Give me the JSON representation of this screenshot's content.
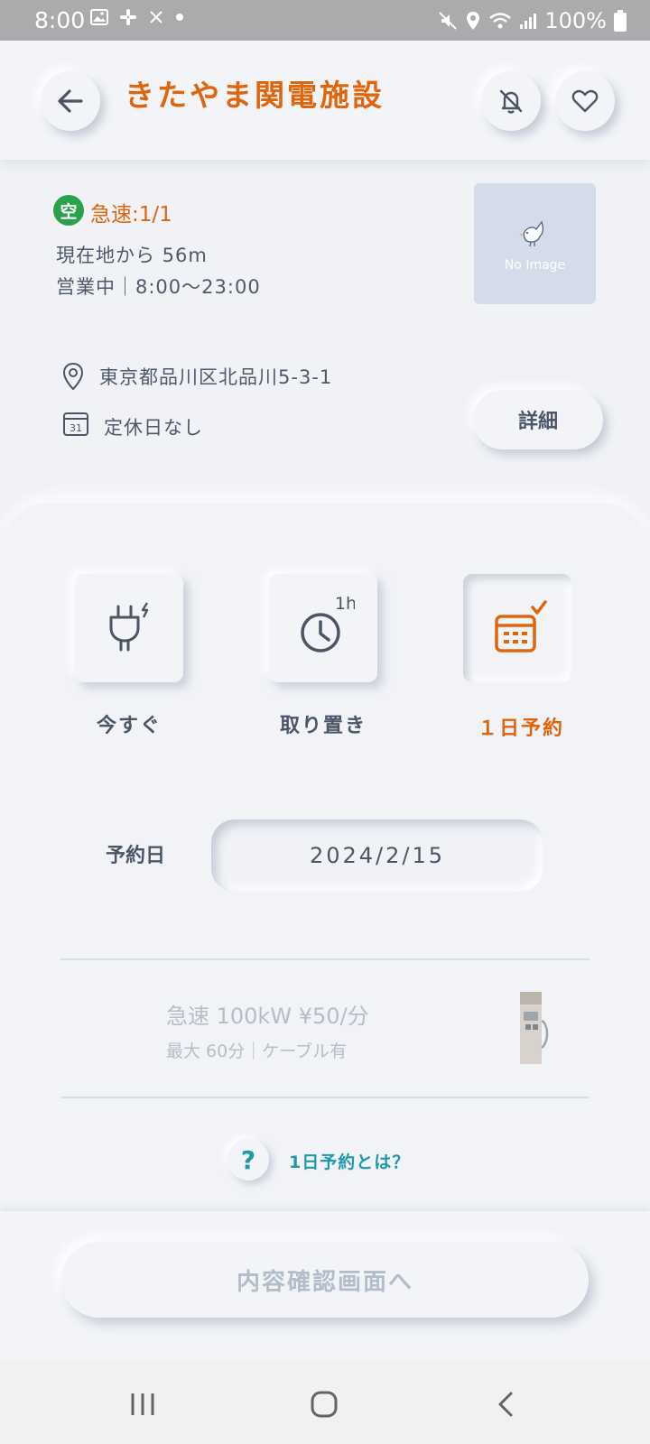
{
  "status_bar": {
    "time": "8:00",
    "battery": "100%",
    "left_icons": [
      "gallery-icon",
      "slack-icon",
      "x-icon",
      "dot-icon"
    ],
    "right_icons": [
      "mute-icon",
      "location-icon",
      "wifi-icon",
      "signal-icon",
      "battery-icon"
    ]
  },
  "header": {
    "title": "きたやま関電施設",
    "accent_color": "#e0660e"
  },
  "station": {
    "availability_badge": "空",
    "availability": "急速:1/1",
    "distance": "現在地から 56m",
    "hours": "営業中｜8:00～23:00",
    "image_placeholder": "No Image",
    "address": "東京都品川区北品川5-3-1",
    "holiday": "定休日なし",
    "detail_button": "詳細"
  },
  "modes": {
    "items": [
      {
        "label": "今すぐ",
        "icon": "plug-icon",
        "selected": false
      },
      {
        "label": "取り置き",
        "icon": "clock-icon",
        "badge": "1h",
        "selected": false
      },
      {
        "label": "１日予約",
        "icon": "calendar-check-icon",
        "selected": true
      }
    ]
  },
  "reservation": {
    "date_label": "予約日",
    "date_value": "2024/2/15"
  },
  "plan": {
    "title": "急速 100kW  ¥50/分",
    "subtitle": "最大 60分｜ケーブル有"
  },
  "help": {
    "icon": "?",
    "text": "1日予約とは？"
  },
  "footer": {
    "confirm_button": "内容確認画面へ"
  }
}
